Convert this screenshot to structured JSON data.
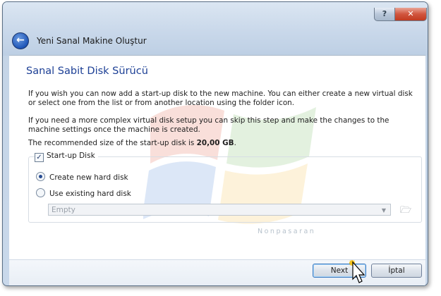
{
  "window": {
    "title": "Yeni Sanal Makine Oluştur",
    "help_label": "?",
    "close_label": "✕",
    "back_icon": "back-arrow-icon"
  },
  "page": {
    "section_title": "Sanal Sabit Disk Sürücü",
    "para1": "If you wish you can now add a start-up disk to the new machine. You can either create a new virtual disk or select one from the list or from another location using the folder icon.",
    "para2": "If you need a more complex virtual disk setup you can skip this step and make the changes to the machine settings once the machine is created.",
    "para3_prefix": "The recommended size of the start-up disk is ",
    "para3_size": "20,00 GB",
    "para3_suffix": "."
  },
  "startup_disk": {
    "label": "Start-up Disk",
    "checked": true,
    "options": [
      {
        "label": "Create new hard disk",
        "selected": true
      },
      {
        "label": "Use existing hard disk",
        "selected": false
      }
    ],
    "combo_value": "Empty",
    "combo_enabled": false
  },
  "watermark_text": "Nonpasaran",
  "footer": {
    "next_label": "Next",
    "cancel_label": "İptal"
  },
  "colors": {
    "section_title": "#1c3f95",
    "titlebar": "#c9d8ea",
    "accent_button": "#3e7bc0"
  }
}
